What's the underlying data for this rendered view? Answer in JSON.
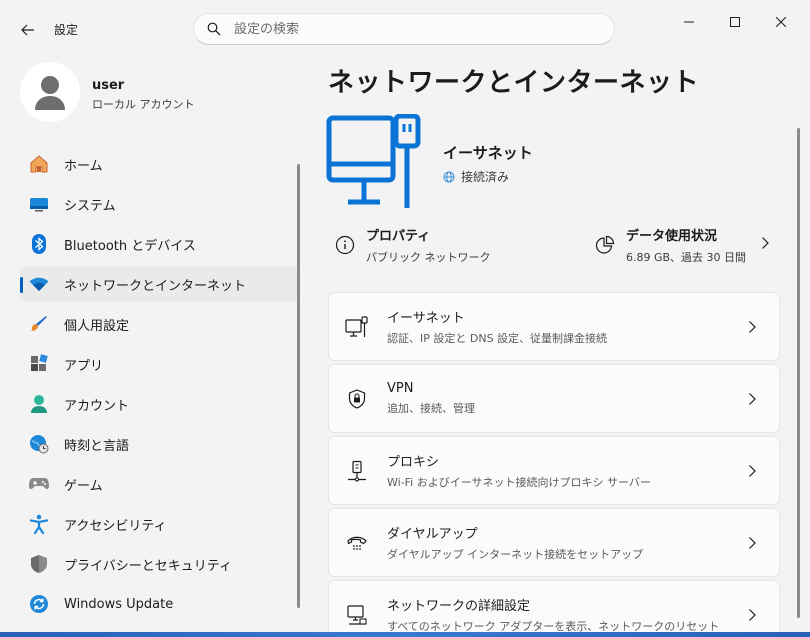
{
  "titlebar": {
    "app_title": "設定",
    "search_placeholder": "設定の検索"
  },
  "user": {
    "name": "user",
    "account_type": "ローカル アカウント"
  },
  "sidebar": {
    "items": [
      {
        "label": "ホーム",
        "icon": "home-icon"
      },
      {
        "label": "システム",
        "icon": "system-icon"
      },
      {
        "label": "Bluetooth とデバイス",
        "icon": "bluetooth-icon"
      },
      {
        "label": "ネットワークとインターネット",
        "icon": "wifi-icon",
        "selected": true
      },
      {
        "label": "個人用設定",
        "icon": "brush-icon"
      },
      {
        "label": "アプリ",
        "icon": "apps-icon"
      },
      {
        "label": "アカウント",
        "icon": "account-icon"
      },
      {
        "label": "時刻と言語",
        "icon": "globe-clock-icon"
      },
      {
        "label": "ゲーム",
        "icon": "gamepad-icon"
      },
      {
        "label": "アクセシビリティ",
        "icon": "accessibility-icon"
      },
      {
        "label": "プライバシーとセキュリティ",
        "icon": "shield-icon"
      },
      {
        "label": "Windows Update",
        "icon": "update-icon"
      }
    ]
  },
  "main": {
    "title": "ネットワークとインターネット",
    "hero": {
      "name": "イーサネット",
      "status": "接続済み"
    },
    "properties": {
      "title": "プロパティ",
      "subtitle": "パブリック ネットワーク"
    },
    "data_usage": {
      "title": "データ使用状況",
      "subtitle": "6.89 GB、過去 30 日間"
    },
    "cards": [
      {
        "title": "イーサネット",
        "subtitle": "認証、IP 設定と DNS 設定、従量制課金接続",
        "icon": "ethernet-icon"
      },
      {
        "title": "VPN",
        "subtitle": "追加、接続、管理",
        "icon": "vpn-shield-icon"
      },
      {
        "title": "プロキシ",
        "subtitle": "Wi-Fi およびイーサネット接続向けプロキシ サーバー",
        "icon": "proxy-icon"
      },
      {
        "title": "ダイヤルアップ",
        "subtitle": "ダイヤルアップ インターネット接続をセットアップ",
        "icon": "dialup-icon"
      },
      {
        "title": "ネットワークの詳細設定",
        "subtitle": "すべてのネットワーク アダプターを表示、ネットワークのリセット",
        "icon": "advanced-network-icon"
      }
    ]
  },
  "colors": {
    "accent": "#005fb8",
    "hero_blue": "#0a74d6"
  }
}
